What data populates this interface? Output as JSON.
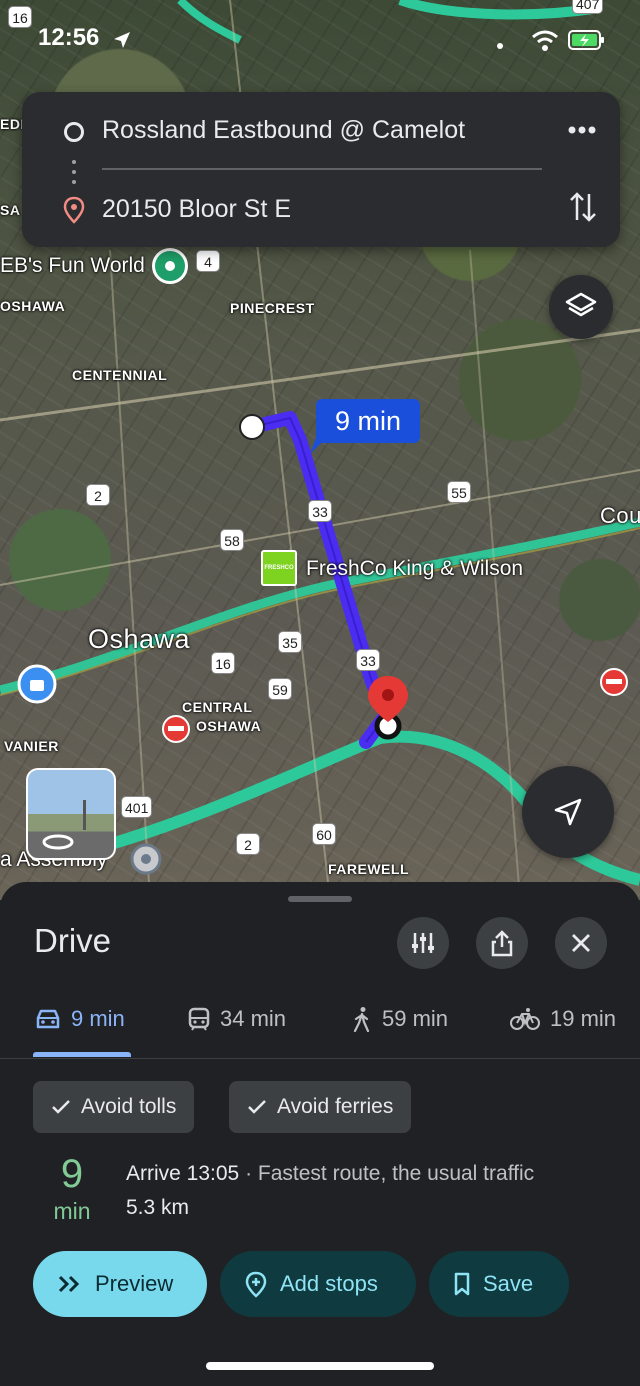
{
  "status_bar": {
    "time": "12:56"
  },
  "search": {
    "origin": "Rossland Eastbound @ Camelot",
    "destination": "20150 Bloor St E"
  },
  "map": {
    "labels": {
      "pinecrest": "PINECREST",
      "centennial": "CENTENNIAL",
      "oshawa_small": "OSHAWA",
      "oshawa_big": "Oshawa",
      "central_oshawa_1": "CENTRAL",
      "central_oshawa_2": "OSHAWA",
      "vanier": "VANIER",
      "farewell": "FAREWELL",
      "edge_edi": "EDI",
      "edge_sa": "SA",
      "edge_cou": "Cou"
    },
    "pois": {
      "fun_world": "EB's Fun World",
      "freshco": "FreshCo King & Wilson",
      "freshco_logo": "FRESHCO",
      "assembly": "a Assembly"
    },
    "shields": {
      "s16_top": "16",
      "s407": "407",
      "s4": "4",
      "s2a": "2",
      "s33a": "33",
      "s55": "55",
      "s58": "58",
      "s35": "35",
      "s16b": "16",
      "s33b": "33",
      "s59": "59",
      "s401": "401",
      "s60": "60",
      "s2b": "2"
    },
    "eta_bubble": "9 min"
  },
  "sheet": {
    "title": "Drive",
    "modes": [
      {
        "label": "9 min",
        "icon": "car-icon"
      },
      {
        "label": "34 min",
        "icon": "transit-icon"
      },
      {
        "label": "59 min",
        "icon": "walk-icon"
      },
      {
        "label": "19 min",
        "icon": "bike-icon"
      }
    ],
    "chips": {
      "avoid_tolls": "Avoid tolls",
      "avoid_ferries": "Avoid ferries"
    },
    "eta_number": "9",
    "eta_unit": "min",
    "arrive": "Arrive 13:05",
    "route_desc": " · Fastest route, the usual traffic",
    "distance": "5.3 km",
    "buttons": {
      "preview": "Preview",
      "add_stops": "Add stops",
      "save": "Save"
    }
  },
  "colors": {
    "route": "#4a2df0",
    "highway": "#2ec99a",
    "accent": "#8ab4f8",
    "eta_green": "#81c995",
    "preview_bg": "#78d9ec"
  }
}
